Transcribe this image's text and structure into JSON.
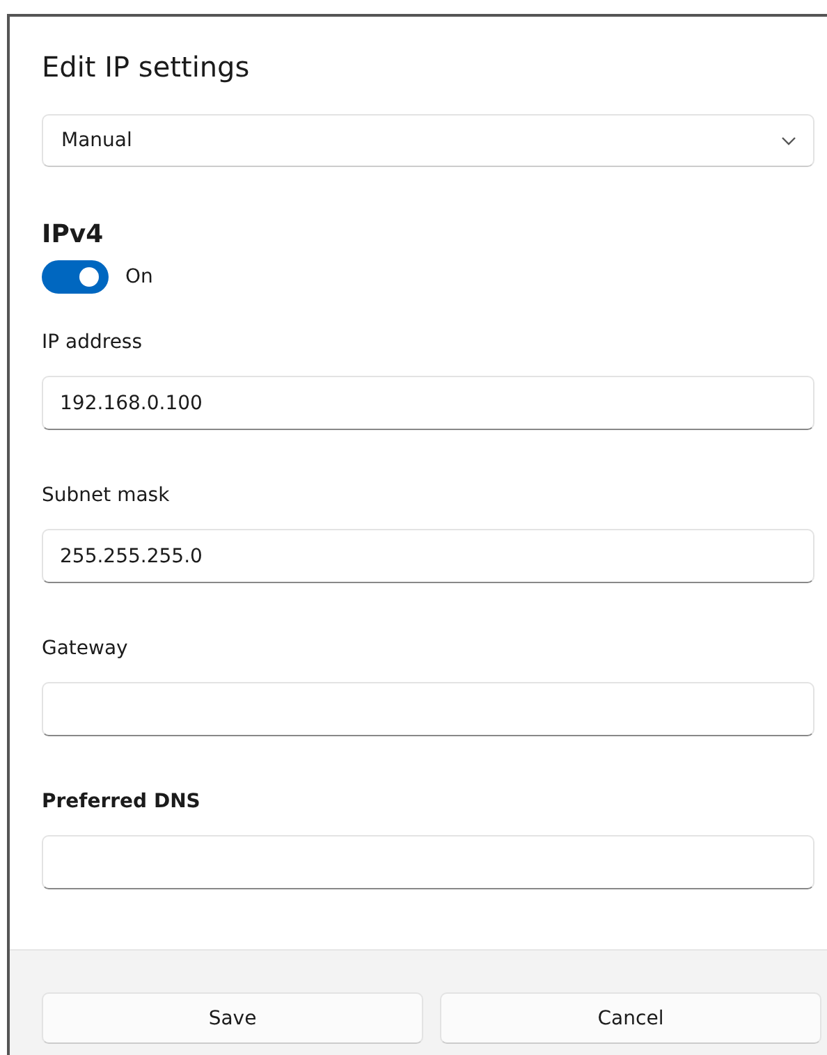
{
  "dialog": {
    "title": "Edit IP settings",
    "mode_select": {
      "value": "Manual"
    },
    "section": {
      "title": "IPv4",
      "toggle": {
        "on": true,
        "label": "On"
      }
    },
    "fields": [
      {
        "label": "IP address",
        "value": "192.168.0.100",
        "emphasized": false
      },
      {
        "label": "Subnet mask",
        "value": "255.255.255.0",
        "emphasized": false
      },
      {
        "label": "Gateway",
        "emphasized": false
      },
      {
        "label": "Preferred DNS",
        "emphasized": true
      }
    ],
    "buttons": [
      {
        "label": "Save"
      },
      {
        "label": "Cancel"
      }
    ]
  }
}
